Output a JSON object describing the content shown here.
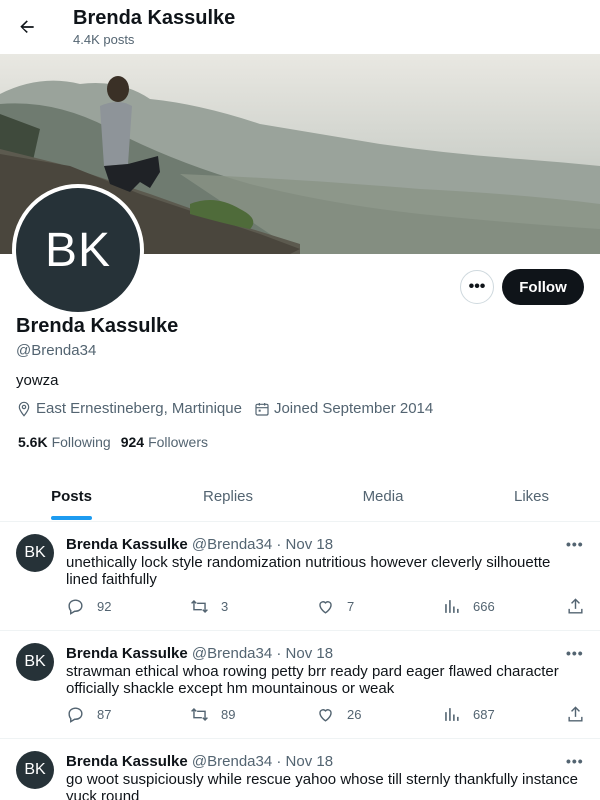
{
  "header": {
    "name": "Brenda Kassulke",
    "post_count": "4.4K posts"
  },
  "profile": {
    "initials": "BK",
    "name": "Brenda Kassulke",
    "handle": "@Brenda34",
    "bio": "yowza",
    "location": "East Ernestineberg, Martinique",
    "joined": "Joined September 2014",
    "following_count": "5.6K",
    "following_label": "Following",
    "followers_count": "924",
    "followers_label": "Followers",
    "follow_label": "Follow",
    "more_label": "•••"
  },
  "tabs": [
    {
      "label": "Posts"
    },
    {
      "label": "Replies"
    },
    {
      "label": "Media"
    },
    {
      "label": "Likes"
    }
  ],
  "tweets": [
    {
      "initials": "BK",
      "name": "Brenda Kassulke",
      "handle": "@Brenda34",
      "date": "Nov 18",
      "text": "unethically lock style randomization nutritious however cleverly silhouette lined faithfully",
      "replies": "92",
      "reposts": "3",
      "likes": "7",
      "views": "666"
    },
    {
      "initials": "BK",
      "name": "Brenda Kassulke",
      "handle": "@Brenda34",
      "date": "Nov 18",
      "text": "strawman ethical whoa rowing petty brr ready pard eager flawed character officially shackle except hm mountainous or weak",
      "replies": "87",
      "reposts": "89",
      "likes": "26",
      "views": "687"
    },
    {
      "initials": "BK",
      "name": "Brenda Kassulke",
      "handle": "@Brenda34",
      "date": "Nov 18",
      "text": "go woot suspiciously while rescue yahoo whose till sternly thankfully instance yuck round"
    }
  ],
  "separator": "·",
  "tweet_more": "•••",
  "colors": {
    "accent": "#1d9bf0",
    "text": "#0f1419",
    "muted": "#536471",
    "avatar_bg": "#263238"
  }
}
